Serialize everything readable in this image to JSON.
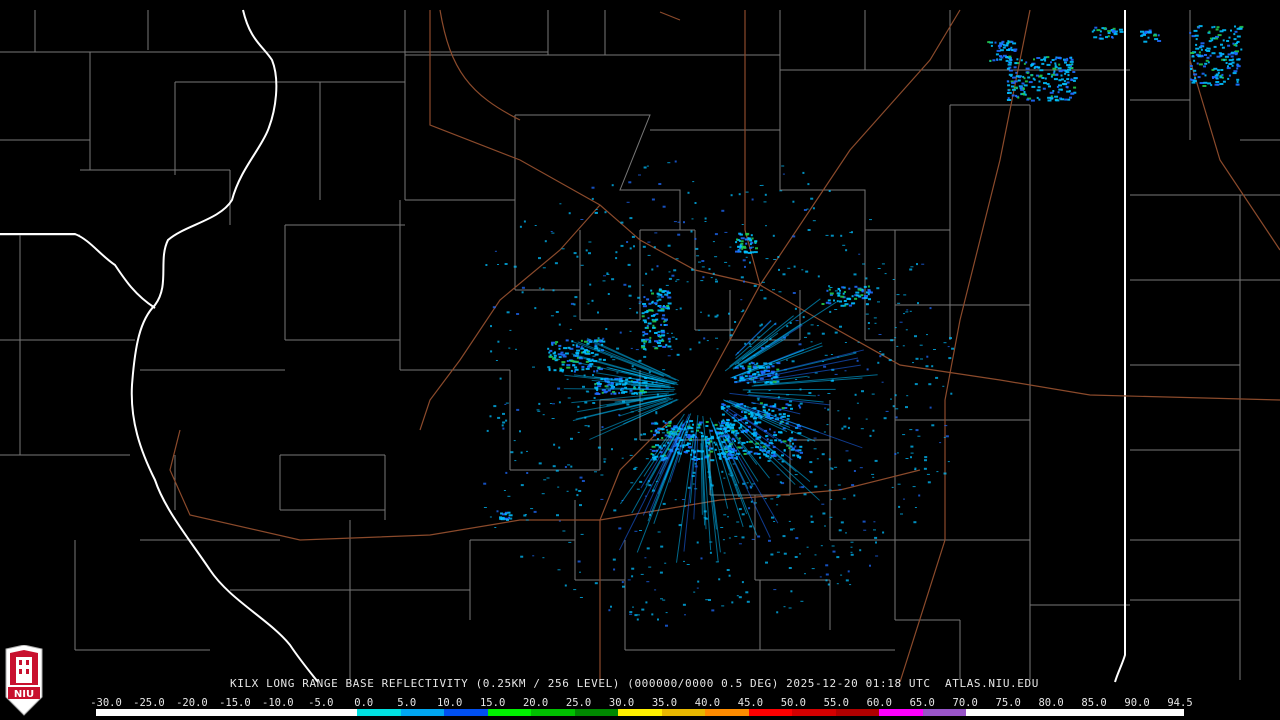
{
  "product_title": "KILX LONG RANGE BASE REFLECTIVITY (0.25KM / 256 LEVEL) (000000/0000 0.5 DEG) 2025-12-20 01:18 UTC  ATLAS.NIU.EDU",
  "logo_text": "NIU",
  "scale": {
    "labels": [
      "-30.0",
      "-25.0",
      "-20.0",
      "-15.0",
      "-10.0",
      "-5.0",
      "0.0",
      "5.0",
      "10.0",
      "15.0",
      "20.0",
      "25.0",
      "30.0",
      "35.0",
      "40.0",
      "45.0",
      "50.0",
      "55.0",
      "60.0",
      "65.0",
      "70.0",
      "75.0",
      "80.0",
      "85.0",
      "90.0",
      "94.5"
    ],
    "colors": [
      "#ffffff",
      "#ffffff",
      "#ffffff",
      "#ffffff",
      "#ffffff",
      "#ffffff",
      "#00e0e0",
      "#00a6f0",
      "#0050f0",
      "#00f000",
      "#00c000",
      "#008800",
      "#fff000",
      "#e8b800",
      "#ff8c00",
      "#ff0000",
      "#d40000",
      "#b00000",
      "#ff00ff",
      "#9955c9",
      "#ffffff",
      "#ffffff",
      "#ffffff",
      "#ffffff",
      "#ffffff"
    ]
  },
  "colors": {
    "background": "#000000",
    "county_lines": "#8c8c8c",
    "state_lines": "#ffffff",
    "highways": "#8b4a2b",
    "echo_light": "#00bfff",
    "echo_medium": "#1e6bff",
    "echo_heavy": "#22c84a"
  }
}
